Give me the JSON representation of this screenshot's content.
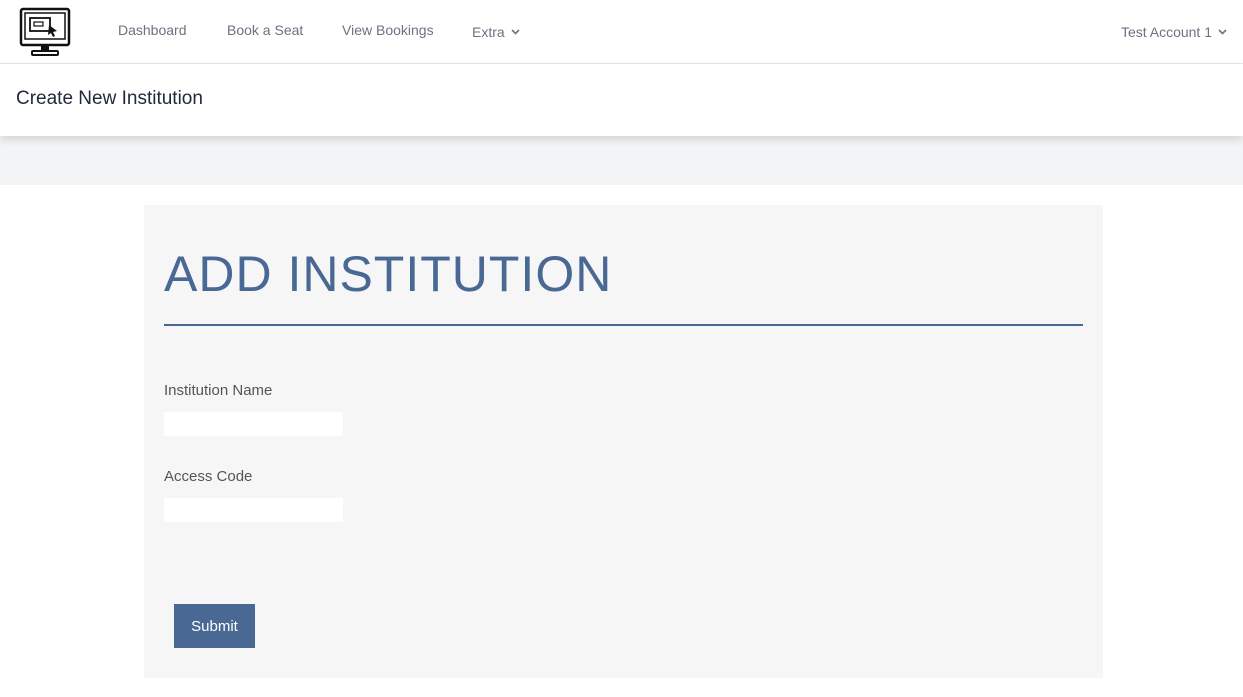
{
  "nav": {
    "links": [
      {
        "label": "Dashboard"
      },
      {
        "label": "Book a Seat"
      },
      {
        "label": "View Bookings"
      },
      {
        "label": "Extra"
      }
    ],
    "account": "Test Account 1"
  },
  "header": {
    "title": "Create New Institution"
  },
  "form": {
    "title": "ADD INSTITUTION",
    "fields": [
      {
        "label": "Institution Name",
        "value": ""
      },
      {
        "label": "Access Code",
        "value": ""
      }
    ],
    "submit_label": "Submit"
  },
  "colors": {
    "accent": "#4a6894",
    "card_bg": "#f6f6f6",
    "band_bg": "#f3f4f6"
  }
}
